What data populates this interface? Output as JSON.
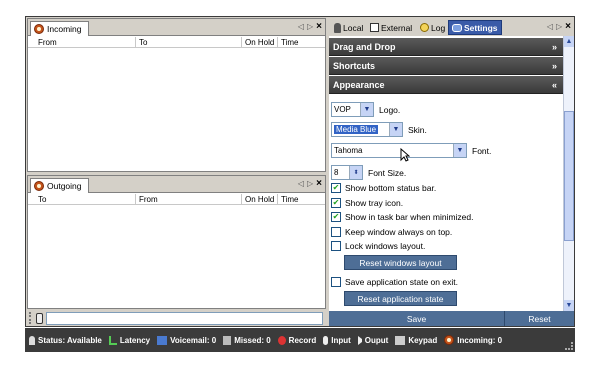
{
  "incoming": {
    "tab_label": "Incoming",
    "columns": [
      "From",
      "To",
      "On Hold",
      "Time"
    ]
  },
  "outgoing": {
    "tab_label": "Outgoing",
    "columns": [
      "To",
      "From",
      "On Hold",
      "Time"
    ]
  },
  "pane_controls": {
    "prev": "◁",
    "next": "▷",
    "close": "×"
  },
  "right_tabs": [
    "Local",
    "External",
    "Log",
    "Settings"
  ],
  "sections": {
    "drag_drop": "Drag and Drop",
    "shortcuts": "Shortcuts",
    "appearance": "Appearance",
    "collapsed_chevron": "»",
    "expanded_chevron": "«"
  },
  "appearance": {
    "logo_value": "VOP",
    "logo_label": "Logo.",
    "skin_value": "Media Blue",
    "skin_label": "Skin.",
    "font_value": "Tahoma",
    "font_label": "Font.",
    "font_size_value": "8",
    "font_size_label": "Font Size.",
    "checkboxes": [
      {
        "label": "Show bottom status bar.",
        "checked": true
      },
      {
        "label": "Show tray icon.",
        "checked": true
      },
      {
        "label": "Show in task bar when minimized.",
        "checked": true
      },
      {
        "label": "Keep window always on top.",
        "checked": false
      },
      {
        "label": "Lock windows layout.",
        "checked": false
      }
    ],
    "reset_layout_button": "Reset windows layout",
    "save_state_label": "Save application state on exit.",
    "save_state_checked": false,
    "reset_state_button": "Reset application state"
  },
  "footer": {
    "save": "Save",
    "reset": "Reset"
  },
  "status_bar": {
    "status": "Status: Available",
    "latency": "Latency",
    "voicemail": "Voicemail: 0",
    "missed": "Missed: 0",
    "record": "Record",
    "input": "Input",
    "output": "Ouput",
    "keypad": "Keypad",
    "incoming": "Incoming: 0"
  },
  "colors": {
    "accent": "#4e6e96",
    "header_dark": "#3b3b3b",
    "tab_active": "#3a5ba8"
  }
}
